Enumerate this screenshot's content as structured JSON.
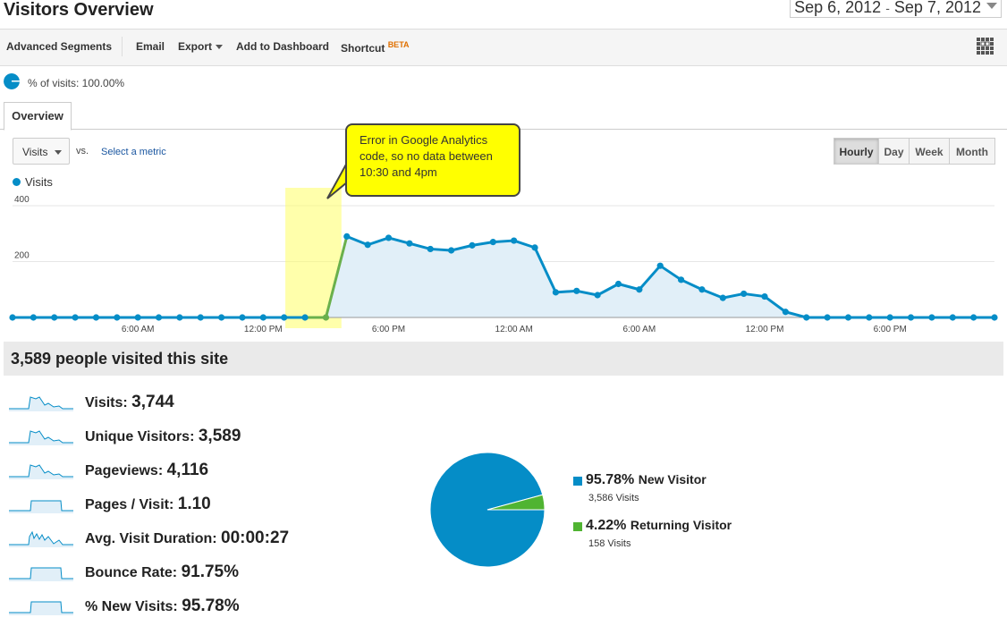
{
  "header": {
    "title": "Visitors Overview",
    "date_start": "Sep 6, 2012",
    "date_sep": "-",
    "date_end": "Sep 7, 2012"
  },
  "toolbar": {
    "advanced_segments": "Advanced Segments",
    "email": "Email",
    "export": "Export",
    "add_to_dashboard": "Add to Dashboard",
    "shortcut": "Shortcut",
    "beta": "BETA"
  },
  "segment": {
    "text": "% of visits: 100.00%"
  },
  "tabs": {
    "overview": "Overview"
  },
  "controls": {
    "metric": "Visits",
    "vs": "vs.",
    "select_metric": "Select a metric",
    "granularity": [
      "Hourly",
      "Day",
      "Week",
      "Month"
    ],
    "active_granularity": "Hourly"
  },
  "callout": {
    "line1": "Error in Google Analytics",
    "line2": "code, so no data between",
    "line3": "10:30  and 4pm"
  },
  "chart_data": {
    "type": "line",
    "legend": [
      "Visits"
    ],
    "series": [
      {
        "name": "Visits",
        "color": "#058dc7",
        "values": [
          0,
          0,
          0,
          0,
          0,
          0,
          0,
          0,
          0,
          0,
          0,
          0,
          0,
          0,
          0,
          0,
          290,
          260,
          285,
          265,
          245,
          240,
          258,
          270,
          275,
          250,
          90,
          95,
          80,
          120,
          100,
          185,
          135,
          100,
          70,
          85,
          75,
          20,
          0,
          0,
          0,
          0,
          0,
          0,
          0,
          0,
          0,
          0
        ]
      }
    ],
    "y_ticks": [
      "400",
      "200"
    ],
    "ylim": [
      0,
      400
    ],
    "x_tick_labels": [
      "6:00 AM",
      "12:00 PM",
      "6:00 PM",
      "12:00 AM",
      "6:00 AM",
      "12:00 PM",
      "6:00 PM"
    ],
    "x_tick_indices": [
      6,
      12,
      18,
      24,
      30,
      36,
      42
    ],
    "highlighted_gap": [
      14,
      16
    ],
    "grid": true
  },
  "summary": {
    "title": "3,589 people visited this site"
  },
  "metrics": [
    {
      "label": "Visits:",
      "value": "3,744"
    },
    {
      "label": "Unique Visitors:",
      "value": "3,589"
    },
    {
      "label": "Pageviews:",
      "value": "4,116"
    },
    {
      "label": "Pages / Visit:",
      "value": "1.10"
    },
    {
      "label": "Avg. Visit Duration:",
      "value": "00:00:27"
    },
    {
      "label": "Bounce Rate:",
      "value": "91.75%"
    },
    {
      "label": "% New Visits:",
      "value": "95.78%"
    }
  ],
  "pie": {
    "slices": [
      {
        "name": "New Visitor",
        "pct": "95.78%",
        "value": 95.78,
        "sub": "3,586 Visits",
        "color": "#058dc7"
      },
      {
        "name": "Returning Visitor",
        "pct": "4.22%",
        "value": 4.22,
        "sub": "158 Visits",
        "color": "#50b432"
      }
    ]
  }
}
